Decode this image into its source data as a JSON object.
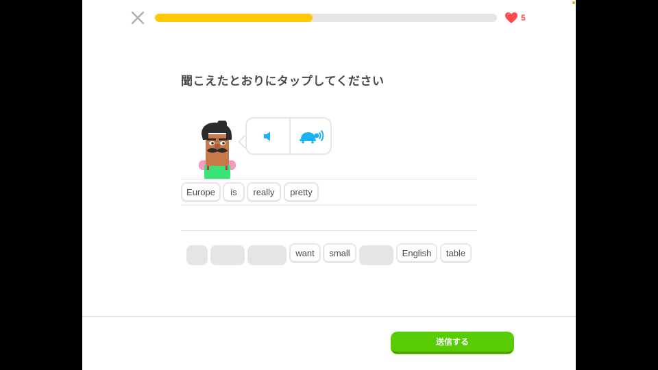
{
  "header": {
    "close_icon": "close-icon",
    "progress": 0.46,
    "progress_color": "#ffc800",
    "hearts_icon": "heart-icon",
    "hearts_count": "5",
    "hearts_color": "#ff4b4b"
  },
  "challenge": {
    "prompt": "聞こえたとおりにタップしてください",
    "character_icon": "character-avatar",
    "audio_normal_icon": "speaker-icon",
    "audio_slow_icon": "turtle-slow-icon"
  },
  "answer": {
    "tiles": [
      "Europe",
      "is",
      "really",
      "pretty"
    ]
  },
  "word_bank": {
    "tiles": [
      "",
      "",
      "",
      "want",
      "small",
      "",
      "English",
      "table"
    ]
  },
  "footer": {
    "submit_label": "送信する",
    "submit_color": "#58cc02"
  }
}
